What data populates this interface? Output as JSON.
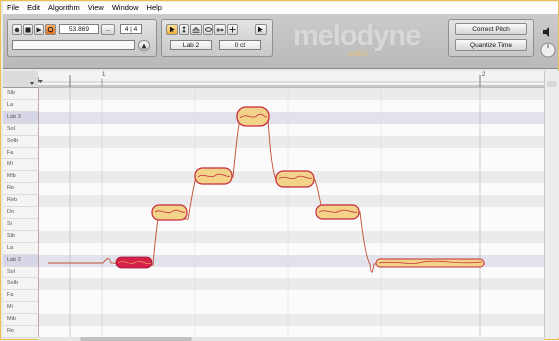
{
  "menu": [
    "File",
    "Edit",
    "Algorithm",
    "View",
    "Window",
    "Help"
  ],
  "transport": {
    "position": "53.869",
    "dots": "...",
    "time_sig": "4 | 4"
  },
  "pitch_field": "Lab 2",
  "cent_field": "0 ct",
  "logo": {
    "main": "melodyne",
    "sub": "editor"
  },
  "macros": {
    "correct_pitch": "Correct Pitch",
    "quantize_time": "Quantize Time"
  },
  "ruler": {
    "bar1": "1",
    "bar2": "2"
  },
  "pitch_labels": [
    "Sib",
    "La",
    "Lab 3",
    "Sol",
    "Solb",
    "Fa",
    "Mi",
    "Mib",
    "Re",
    "Reb",
    "Do",
    "Si",
    "Sib",
    "La",
    "Lab 2",
    "Sol",
    "Solb",
    "Fa",
    "Mi",
    "Mib",
    "Re"
  ],
  "colors": {
    "blob_fill": "#f3d38a",
    "blob_outline": "#c8283c",
    "selected_blob": "#d6204a",
    "pitch_line": "#c44a2e"
  }
}
